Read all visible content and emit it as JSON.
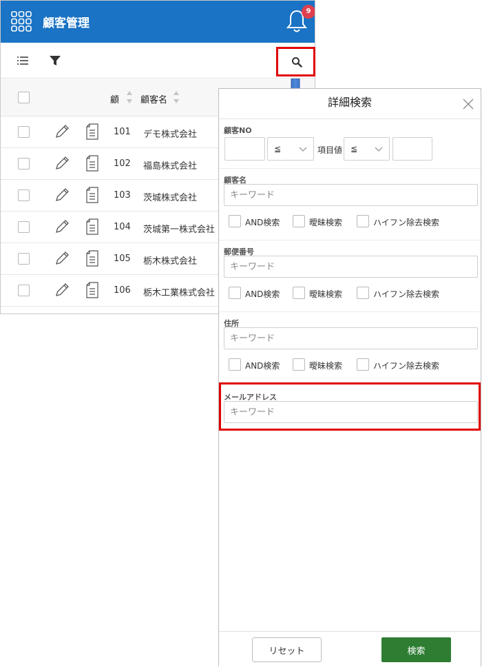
{
  "app": {
    "title": "顧客管理",
    "notification_count": "9",
    "accent": "#1a73c4"
  },
  "table": {
    "headers": {
      "no": "顧",
      "name": "顧客名"
    },
    "rows": [
      {
        "no": "101",
        "name": "デモ株式会社"
      },
      {
        "no": "102",
        "name": "福島株式会社"
      },
      {
        "no": "103",
        "name": "茨城株式会社"
      },
      {
        "no": "104",
        "name": "茨城第一株式会社"
      },
      {
        "no": "105",
        "name": "栃木株式会社"
      },
      {
        "no": "106",
        "name": "栃木工業株式会社"
      }
    ]
  },
  "search_panel": {
    "title": "詳細検索",
    "customer_no": {
      "label": "顧客NO",
      "op1": "≦",
      "mid_label": "項目値",
      "op2": "≦"
    },
    "customer_name": {
      "label": "顧客名",
      "placeholder": "キーワード"
    },
    "postal_code": {
      "label": "郵便番号",
      "placeholder": "キーワード"
    },
    "address": {
      "label": "住所",
      "placeholder": "キーワード"
    },
    "email": {
      "label": "メールアドレス",
      "placeholder": "キーワード"
    },
    "options": {
      "and": "AND検索",
      "fuzzy": "曖昧検索",
      "hyphen": "ハイフン除去検索"
    },
    "reset_label": "リセット",
    "search_label": "検索",
    "search_color": "#2e7d32"
  }
}
